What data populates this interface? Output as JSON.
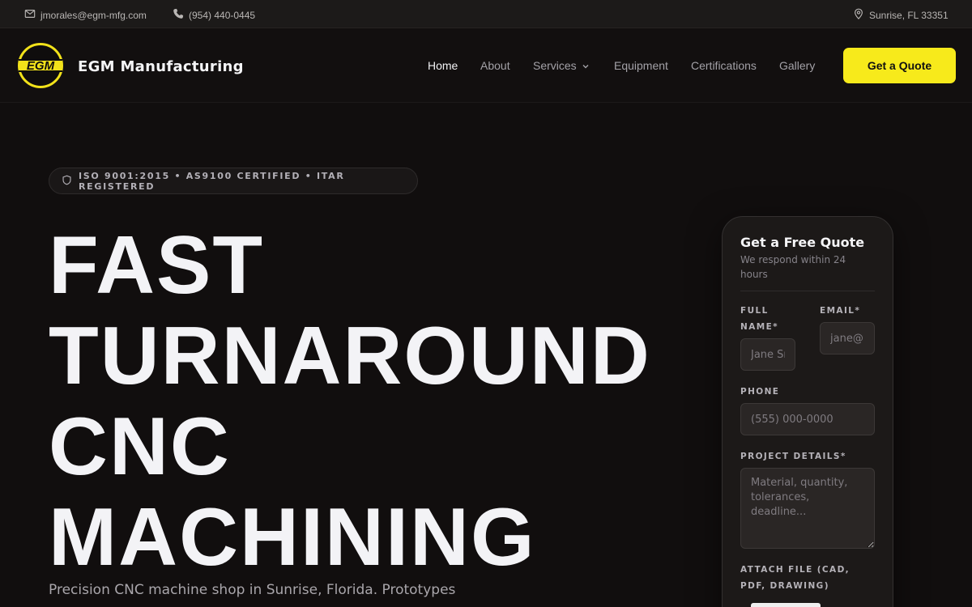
{
  "topbar": {
    "email": "jmorales@egm-mfg.com",
    "phone": "(954) 440-0445",
    "location": "Sunrise, FL 33351"
  },
  "header": {
    "logo_text": "EGM",
    "brand": "EGM Manufacturing",
    "nav": [
      "Home",
      "About",
      "Services",
      "Equipment",
      "Certifications",
      "Gallery"
    ],
    "active_nav": "Home",
    "cta": "Get a Quote"
  },
  "hero": {
    "badge": "ISO 9001:2015 • AS9100 CERTIFIED • ITAR REGISTERED",
    "title_lines": [
      "FAST",
      "TURNAROUND",
      "CNC",
      "MACHINING"
    ],
    "subtitle": "Precision CNC machine shop in Sunrise, Florida. Prototypes"
  },
  "quote_form": {
    "title": "Get a Free Quote",
    "subtitle": "We respond within 24 hours",
    "full_name_label": "FULL NAME*",
    "full_name_placeholder": "Jane Smith",
    "email_label": "EMAIL*",
    "email_placeholder": "jane@",
    "phone_label": "PHONE",
    "phone_placeholder": "(555) 000-0000",
    "details_label": "PROJECT DETAILS*",
    "details_placeholder": "Material, quantity, tolerances, deadline...",
    "attach_label": "ATTACH FILE (CAD, PDF, DRAWING)"
  },
  "colors": {
    "accent": "#f7ea1b",
    "background": "#110e0e",
    "card": "#1c1918"
  }
}
